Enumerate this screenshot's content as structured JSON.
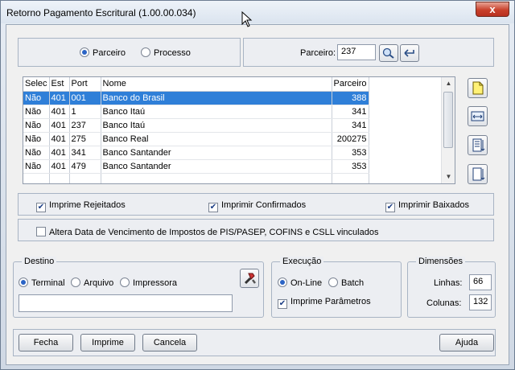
{
  "window": {
    "title": "Retorno Pagamento Escritural (1.00.00.034)",
    "close_glyph": "x"
  },
  "filter": {
    "radio_parceiro": "Parceiro",
    "radio_processo": "Processo",
    "parceiro_label": "Parceiro:",
    "parceiro_value": "237"
  },
  "grid": {
    "columns": [
      "Selec",
      "Est",
      "Port",
      "Nome",
      "Parceiro"
    ],
    "rows": [
      [
        "Não",
        "401",
        "001",
        "Banco do Brasil",
        "388"
      ],
      [
        "Não",
        "401",
        "1",
        "Banco Itaú",
        "341"
      ],
      [
        "Não",
        "401",
        "237",
        "Banco Itaú",
        "341"
      ],
      [
        "Não",
        "401",
        "275",
        "Banco Real",
        "200275"
      ],
      [
        "Não",
        "401",
        "341",
        "Banco Santander",
        "353"
      ],
      [
        "Não",
        "401",
        "479",
        "Banco Santander",
        "353"
      ]
    ],
    "selected_row": 0
  },
  "options": {
    "imprime_rejeitados": "Imprime Rejeitados",
    "imprimir_confirmados": "Imprimir Confirmados",
    "imprimir_baixados": "Imprimir Baixados",
    "altera_data": "Altera Data de Vencimento de Impostos de PIS/PASEP, COFINS e CSLL vinculados"
  },
  "destino": {
    "label": "Destino",
    "terminal": "Terminal",
    "arquivo": "Arquivo",
    "impressora": "Impressora",
    "path_value": ""
  },
  "execucao": {
    "label": "Execução",
    "online": "On-Line",
    "batch": "Batch",
    "imprime_parametros": "Imprime Parâmetros"
  },
  "dimensoes": {
    "label": "Dimensões",
    "linhas_label": "Linhas:",
    "linhas_value": "66",
    "colunas_label": "Colunas:",
    "colunas_value": "132"
  },
  "buttons": {
    "fecha": "Fecha",
    "imprime": "Imprime",
    "cancela": "Cancela",
    "ajuda": "Ajuda"
  },
  "colors": {
    "selection": "#2f7fd8",
    "close": "#c9412c"
  }
}
